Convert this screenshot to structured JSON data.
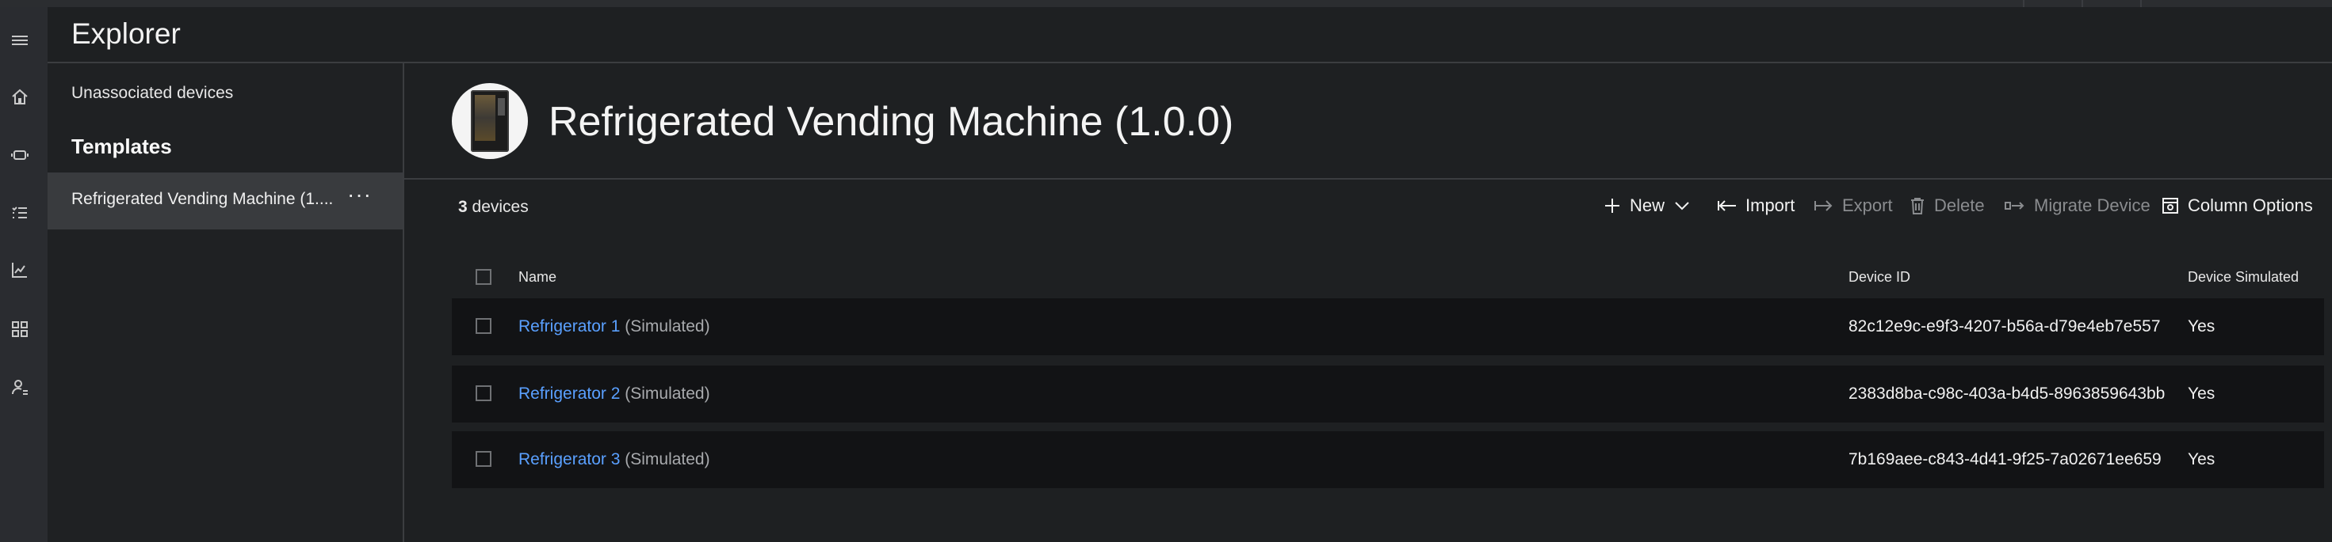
{
  "explorer": {
    "title": "Explorer"
  },
  "rail": {
    "icons": [
      "menu-icon",
      "home-icon",
      "devices-icon",
      "rules-icon",
      "analytics-icon",
      "dashboard-icon",
      "users-icon"
    ]
  },
  "nav": {
    "unassociated": "Unassociated devices",
    "templates_heading": "Templates",
    "selected_template": "Refrigerated Vending Machine (1....",
    "more": "···"
  },
  "main": {
    "title": "Refrigerated Vending Machine (1.0.0)",
    "count_number": "3",
    "count_label": " devices"
  },
  "toolbar": {
    "new": "New",
    "import": "Import",
    "export": "Export",
    "delete": "Delete",
    "migrate": "Migrate Device",
    "columns": "Column Options"
  },
  "table": {
    "headers": {
      "name": "Name",
      "device_id": "Device ID",
      "simulated": "Device Simulated"
    },
    "rows": [
      {
        "name": "Refrigerator 1",
        "sim_tag": "(Simulated)",
        "device_id": "82c12e9c-e9f3-4207-b56a-d79e4eb7e557",
        "simulated": "Yes"
      },
      {
        "name": "Refrigerator 2",
        "sim_tag": "(Simulated)",
        "device_id": "2383d8ba-c98c-403a-b4d5-8963859643bb",
        "simulated": "Yes"
      },
      {
        "name": "Refrigerator 3",
        "sim_tag": "(Simulated)",
        "device_id": "7b169aee-c843-4d41-9f25-7a02671ee659",
        "simulated": "Yes"
      }
    ]
  },
  "colors": {
    "accent_link": "#5aa0ff",
    "background": "#1e2022",
    "row_bg": "#121315",
    "selected_nav": "#393b3e"
  }
}
